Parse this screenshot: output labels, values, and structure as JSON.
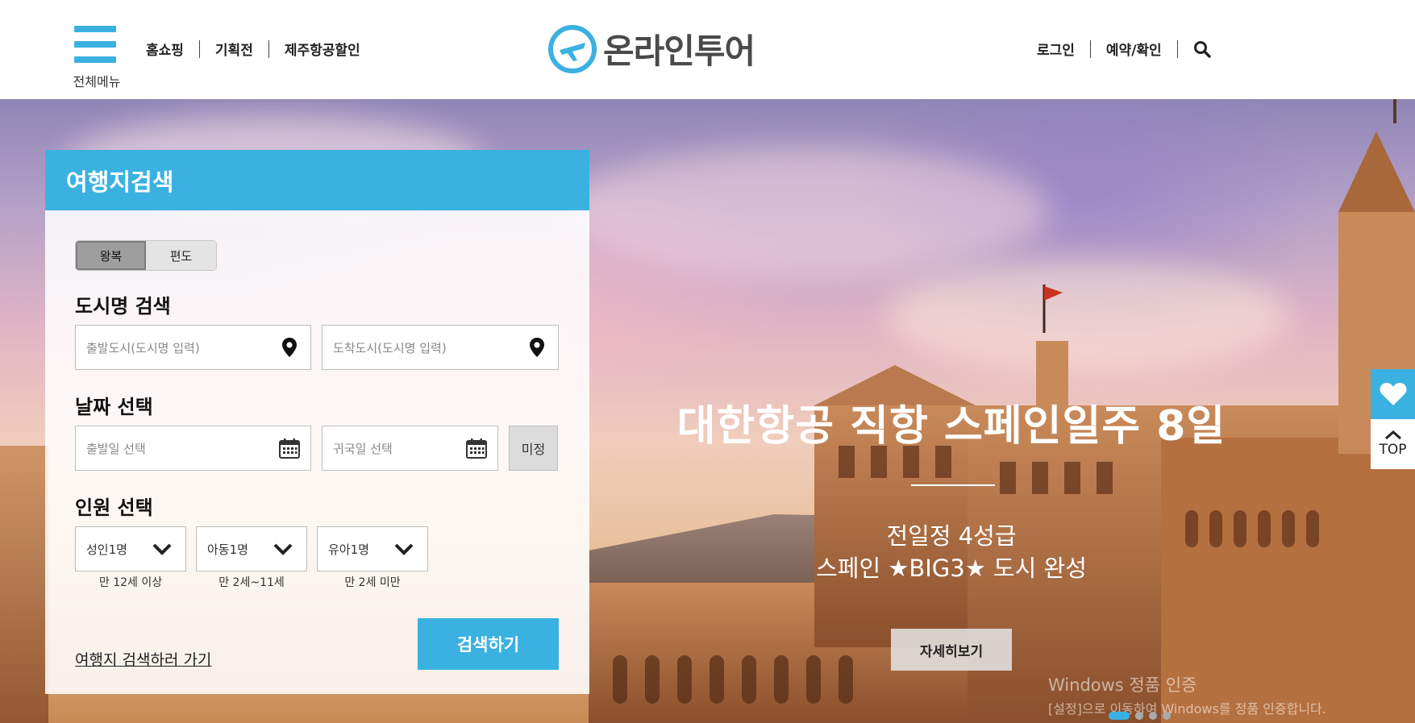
{
  "header": {
    "menu_label": "전체메뉴",
    "nav": [
      "홈쇼핑",
      "기획전",
      "제주항공할인"
    ],
    "logo_text": "온라인투어",
    "util": [
      "로그인",
      "예약/확인"
    ]
  },
  "hero": {
    "title": "대한항공 직항 스페인일주 8일",
    "subtitle_line1": "전일정 4성급",
    "subtitle_line2": "스페인 ★BIG3★ 도시 완성",
    "detail_button": "자세히보기",
    "slide_count": 4,
    "active_slide": 1
  },
  "side": {
    "top_label": "TOP"
  },
  "search_panel": {
    "title": "여행지검색",
    "trip_types": [
      "왕복",
      "편도"
    ],
    "selected_trip_type": "왕복",
    "city_section": "도시명 검색",
    "departure_placeholder": "출발도시(도시명 입력)",
    "arrival_placeholder": "도착도시(도시명 입력)",
    "date_section": "날짜 선택",
    "depart_date_placeholder": "출발일 선택",
    "return_date_placeholder": "귀국일 선택",
    "undecided_label": "미정",
    "people_section": "인원 선택",
    "adult": "성인1명",
    "child": "아동1명",
    "infant": "유아1명",
    "adult_note": "만 12세 이상",
    "child_note": "만 2세~11세",
    "infant_note": "만 2세 미만",
    "go_link": "여행지 검색하러 가기",
    "search_button": "검색하기"
  },
  "os_watermark": {
    "line1": "Windows 정품 인증",
    "line2": "[설정]으로 이동하여 Windows를 정품 인증합니다."
  },
  "colors": {
    "accent": "#3bb1e1",
    "text": "#222222"
  }
}
